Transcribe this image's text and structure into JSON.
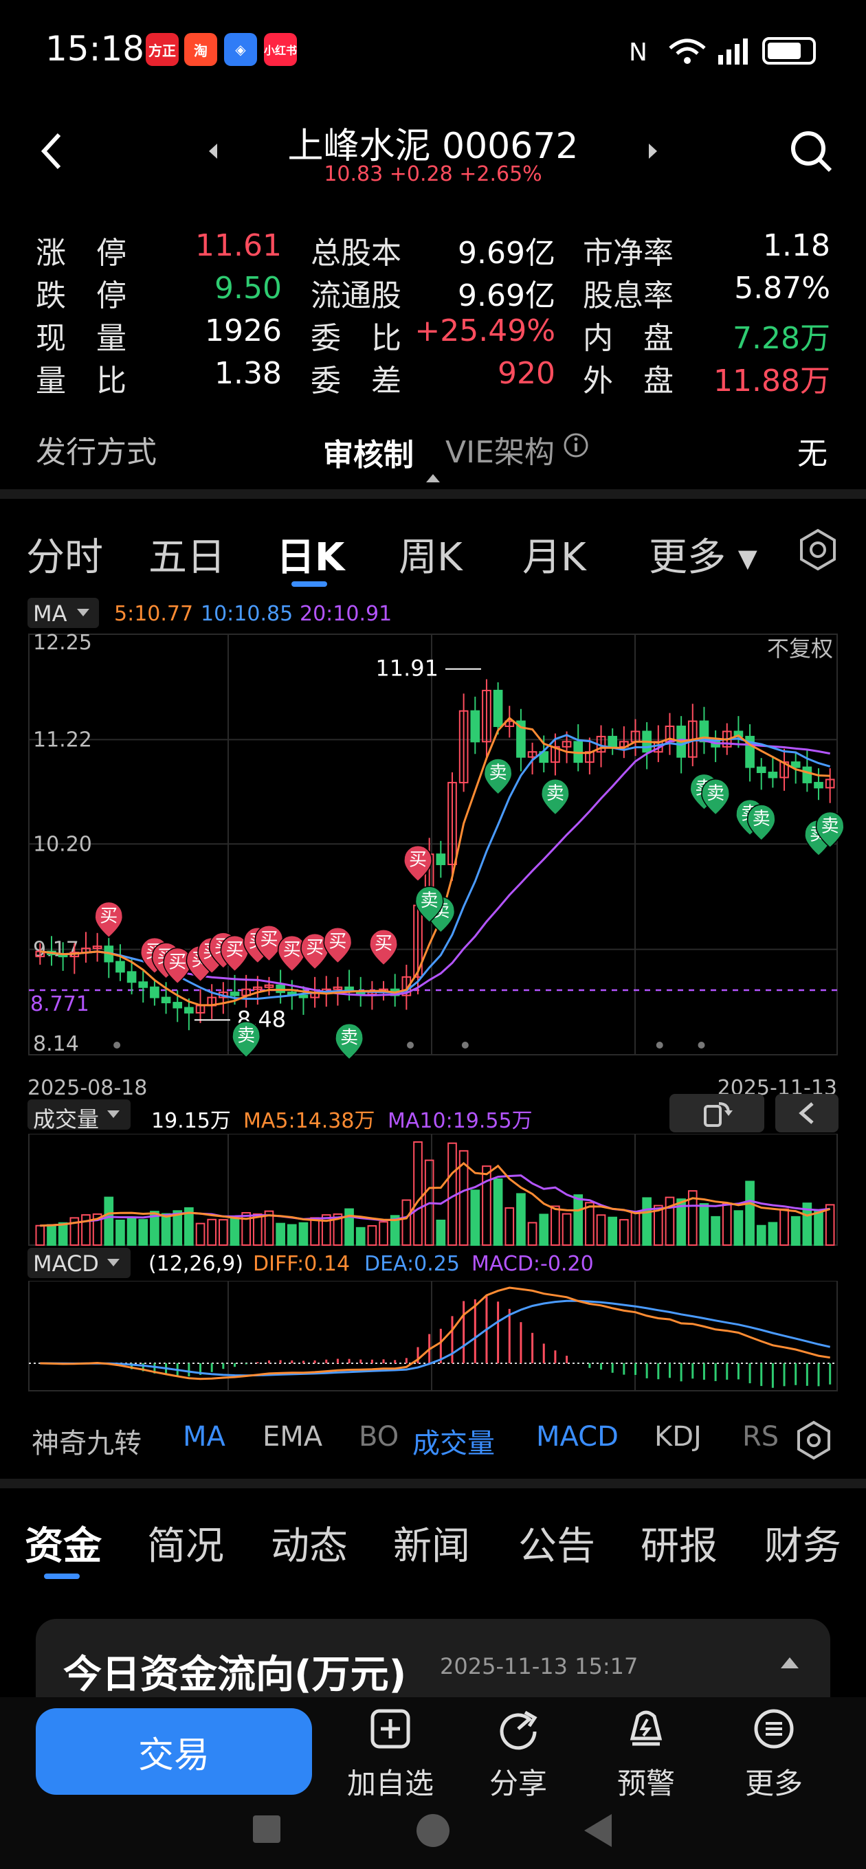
{
  "status_bar": {
    "time": "15:18",
    "app_icons": [
      "方正证券",
      "淘",
      "安全",
      "小红书"
    ]
  },
  "header": {
    "title": "上峰水泥 000672",
    "price_line": "10.83 +0.28 +2.65%",
    "back_icon": "chevron-left-icon",
    "search_icon": "search-icon"
  },
  "quote": {
    "rows": [
      {
        "l1": "涨　停",
        "v1": "11.61",
        "c1": "red",
        "l2": "总股本",
        "v2": "9.69亿",
        "c2": "white",
        "l3": "市净率",
        "v3": "1.18",
        "c3": "white"
      },
      {
        "l1": "跌　停",
        "v1": "9.50",
        "c1": "green",
        "l2": "流通股",
        "v2": "9.69亿",
        "c2": "white",
        "l3": "股息率",
        "v3": "5.87%",
        "c3": "white"
      },
      {
        "l1": "现　量",
        "v1": "1926",
        "c1": "white",
        "l2": "委　比",
        "v2": "+25.49%",
        "c2": "red",
        "l3": "内　盘",
        "v3": "7.28万",
        "c3": "green"
      },
      {
        "l1": "量　比",
        "v1": "1.38",
        "c1": "white",
        "l2": "委　差",
        "v2": "920",
        "c2": "red",
        "l3": "外　盘",
        "v3": "11.88万",
        "c3": "red"
      }
    ],
    "issue_label": "发行方式",
    "issue_value": "审核制",
    "vie_label": "VIE架构",
    "vie_value": "无"
  },
  "chart_tabs": [
    "分时",
    "五日",
    "日K",
    "周K",
    "月K",
    "更多"
  ],
  "active_chart_tab": "日K",
  "ma_legend": {
    "selector": "MA",
    "ma5": "5:10.77",
    "ma10": "10:10.85",
    "ma20": "20:10.91",
    "colors": {
      "ma5": "#ff8c33",
      "ma10": "#4a9bff",
      "ma20": "#b455ff"
    }
  },
  "chart_labels": {
    "fq": "不复权",
    "high_label": "11.91",
    "low_label": "8.48",
    "date_start": "2025-08-18",
    "date_end": "2025-11-13",
    "y_ticks": [
      "12.25",
      "11.22",
      "10.20",
      "9.17",
      "8.14"
    ],
    "ref_price": "8.771"
  },
  "chart_data": {
    "type": "line",
    "x_start": "2025-08-18",
    "x_end": "2025-11-13",
    "ylim": [
      8.14,
      12.25
    ],
    "close": [
      9.15,
      9.12,
      9.1,
      9.14,
      9.18,
      9.2,
      9.05,
      8.95,
      8.85,
      8.8,
      8.7,
      8.65,
      8.6,
      8.55,
      8.62,
      8.7,
      8.75,
      8.72,
      8.78,
      8.8,
      8.82,
      8.75,
      8.72,
      8.7,
      8.74,
      8.78,
      8.8,
      8.76,
      8.73,
      8.75,
      8.78,
      8.72,
      8.9,
      9.6,
      10.1,
      10.0,
      10.8,
      11.5,
      11.2,
      11.7,
      11.35,
      11.4,
      11.05,
      11.1,
      11.0,
      11.15,
      11.2,
      11.0,
      11.1,
      11.25,
      11.15,
      11.2,
      11.3,
      11.1,
      11.2,
      11.35,
      11.05,
      11.4,
      11.2,
      11.15,
      11.3,
      11.25,
      10.95,
      10.9,
      10.85,
      11.0,
      10.95,
      10.8,
      10.75,
      10.83
    ],
    "ma5_last": 10.77,
    "ma10_last": 10.85,
    "ma20_last": 10.91
  },
  "volume": {
    "selector": "成交量",
    "value": "19.15万",
    "ma5": "MA5:14.38万",
    "ma10": "MA10:19.55万"
  },
  "macd": {
    "selector": "MACD",
    "params": "(12,26,9)",
    "diff": "DIFF:0.14",
    "dea": "DEA:0.25",
    "macd": "MACD:-0.20"
  },
  "indicator_tabs": [
    "神奇九转",
    "MA",
    "EMA",
    "BOLL",
    "成交量",
    "MACD",
    "KDJ",
    "RSI"
  ],
  "bottom_tabs": [
    "资金",
    "简况",
    "动态",
    "新闻",
    "公告",
    "研报",
    "财务"
  ],
  "card": {
    "title": "今日资金流向(万元)",
    "date": "2025-11-13 15:17"
  },
  "footer": {
    "trade": "交易",
    "add": "加自选",
    "share": "分享",
    "alert": "预警",
    "more": "更多"
  },
  "markers": {
    "buy": "买",
    "sell": "卖"
  }
}
